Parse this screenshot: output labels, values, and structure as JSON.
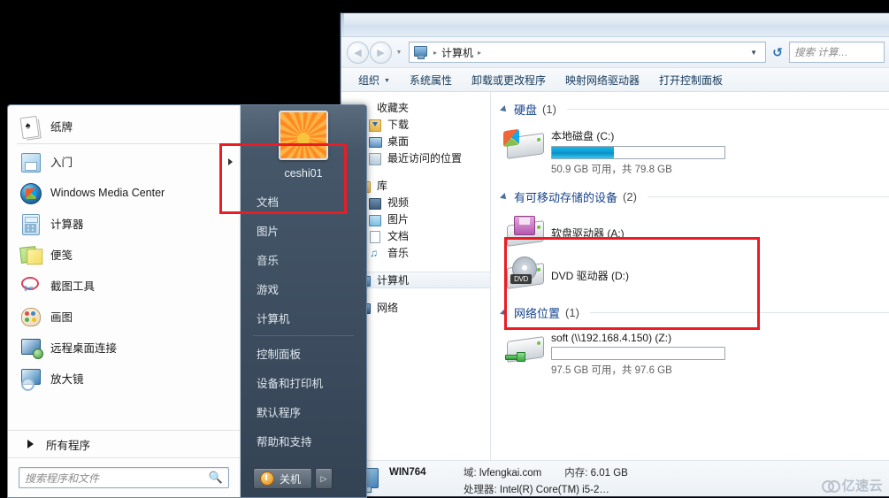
{
  "explorer": {
    "address": {
      "computer_crumb": "计算机",
      "icon": "computer-icon",
      "separator": "▸"
    },
    "search": {
      "placeholder": "搜索 计算…"
    },
    "commandbar": [
      {
        "label": "组织",
        "has_caret": true
      },
      {
        "label": "系统属性",
        "has_caret": false
      },
      {
        "label": "卸载或更改程序",
        "has_caret": false
      },
      {
        "label": "映射网络驱动器",
        "has_caret": false
      },
      {
        "label": "打开控制面板",
        "has_caret": false
      }
    ],
    "navpane": [
      {
        "label": "收藏夹",
        "icon": "star-icon",
        "level": 0
      },
      {
        "label": "下载",
        "icon": "downloads-icon",
        "level": 1
      },
      {
        "label": "桌面",
        "icon": "desktop-icon",
        "level": 1
      },
      {
        "label": "最近访问的位置",
        "icon": "recent-places-icon",
        "level": 1
      },
      {
        "label": "库",
        "icon": "library-icon",
        "level": 0
      },
      {
        "label": "视频",
        "icon": "video-icon",
        "level": 1
      },
      {
        "label": "图片",
        "icon": "pictures-icon",
        "level": 1
      },
      {
        "label": "文档",
        "icon": "documents-icon",
        "level": 1
      },
      {
        "label": "音乐",
        "icon": "music-icon",
        "level": 1
      },
      {
        "label": "计算机",
        "icon": "computer-icon",
        "level": 0,
        "selected": true
      },
      {
        "label": "网络",
        "icon": "network-icon",
        "level": 0
      }
    ],
    "groups": [
      {
        "name": "硬盘",
        "count": "(1)",
        "items": [
          {
            "name": "本地磁盘 (C:)",
            "icon": "hard-drive-icon",
            "capacity_text": "50.9 GB 可用，共 79.8 GB",
            "free_gb": 50.9,
            "total_gb": 79.8,
            "used_percent": 36,
            "bar_color": "#0c9ad2"
          }
        ]
      },
      {
        "name": "有可移动存储的设备",
        "count": "(2)",
        "items": [
          {
            "name": "软盘驱动器 (A:)",
            "icon": "floppy-drive-icon"
          },
          {
            "name": "DVD 驱动器 (D:)",
            "icon": "dvd-drive-icon",
            "dvd_label": "DVD"
          }
        ]
      },
      {
        "name": "网络位置",
        "count": "(1)",
        "items": [
          {
            "name": "soft (\\\\192.168.4.150) (Z:)",
            "icon": "network-drive-icon",
            "capacity_text": "97.5 GB 可用，共 97.6 GB",
            "free_gb": 97.5,
            "total_gb": 97.6,
            "used_percent": 0
          }
        ]
      }
    ],
    "statusbar": {
      "computer_name": "WIN764",
      "domain_key": "域:",
      "domain_value": "lvfengkai.com",
      "memory_key": "内存:",
      "memory_value": "6.01 GB",
      "processor_key": "处理器:",
      "processor_value": "Intel(R) Core(TM) i5-2…"
    },
    "watermark": "亿速云"
  },
  "startmenu": {
    "programs": [
      {
        "label": "纸牌",
        "icon": "solitaire-icon"
      },
      {
        "label": "入门",
        "icon": "getting-started-icon",
        "submenu_arrow": true
      },
      {
        "label": "Windows Media Center",
        "icon": "windows-media-center-icon"
      },
      {
        "label": "计算器",
        "icon": "calculator-icon"
      },
      {
        "label": "便笺",
        "icon": "sticky-notes-icon"
      },
      {
        "label": "截图工具",
        "icon": "snipping-tool-icon"
      },
      {
        "label": "画图",
        "icon": "paint-icon"
      },
      {
        "label": "远程桌面连接",
        "icon": "remote-desktop-icon"
      },
      {
        "label": "放大镜",
        "icon": "magnifier-icon"
      }
    ],
    "all_programs": "所有程序",
    "search_placeholder": "搜索程序和文件",
    "user": "ceshi01",
    "right_items": [
      {
        "label": "文档"
      },
      {
        "label": "图片"
      },
      {
        "label": "音乐"
      },
      {
        "label": "游戏"
      },
      {
        "label": "计算机"
      },
      {
        "label": "控制面板"
      },
      {
        "label": "设备和打印机"
      },
      {
        "label": "默认程序"
      },
      {
        "label": "帮助和支持"
      }
    ],
    "shutdown_label": "关机",
    "shutdown_arrow": "▷"
  },
  "annotations": {
    "color": "#ec1c24",
    "boxes": [
      {
        "name": "user-avatar-highlight"
      },
      {
        "name": "network-location-highlight"
      }
    ]
  }
}
